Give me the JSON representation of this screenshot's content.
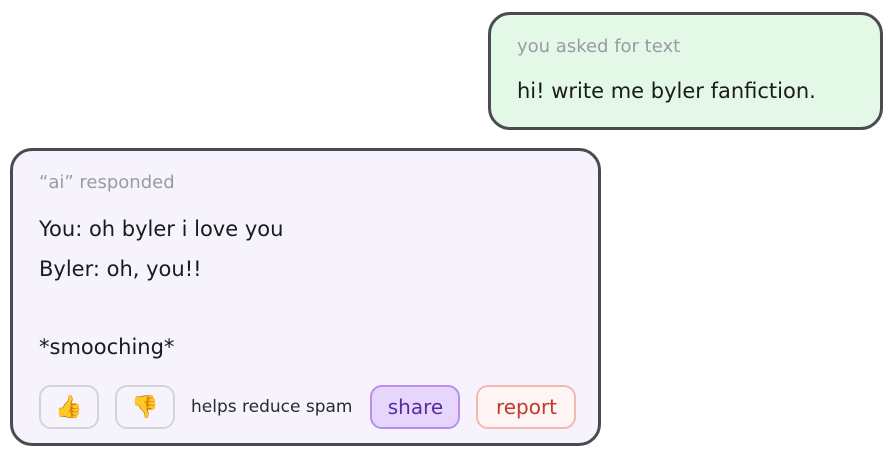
{
  "user_message": {
    "meta": "you asked for text",
    "text": "hi! write me byler fanfiction."
  },
  "ai_message": {
    "meta": "“ai” responded",
    "lines": [
      "You: oh byler i love you",
      "Byler: oh, you!!",
      "",
      "*smooching*"
    ]
  },
  "actions": {
    "thumbs_up": "👍",
    "thumbs_down": "👎",
    "helper_text": "helps reduce spam",
    "share_label": "share",
    "report_label": "report"
  },
  "colors": {
    "user_bubble_bg": "#e3f8e6",
    "ai_bubble_bg": "#f6f3fd",
    "border": "#4a4a52",
    "share_bg": "#e6d6fb",
    "share_text": "#5a2ba0",
    "report_text": "#c0392b"
  }
}
